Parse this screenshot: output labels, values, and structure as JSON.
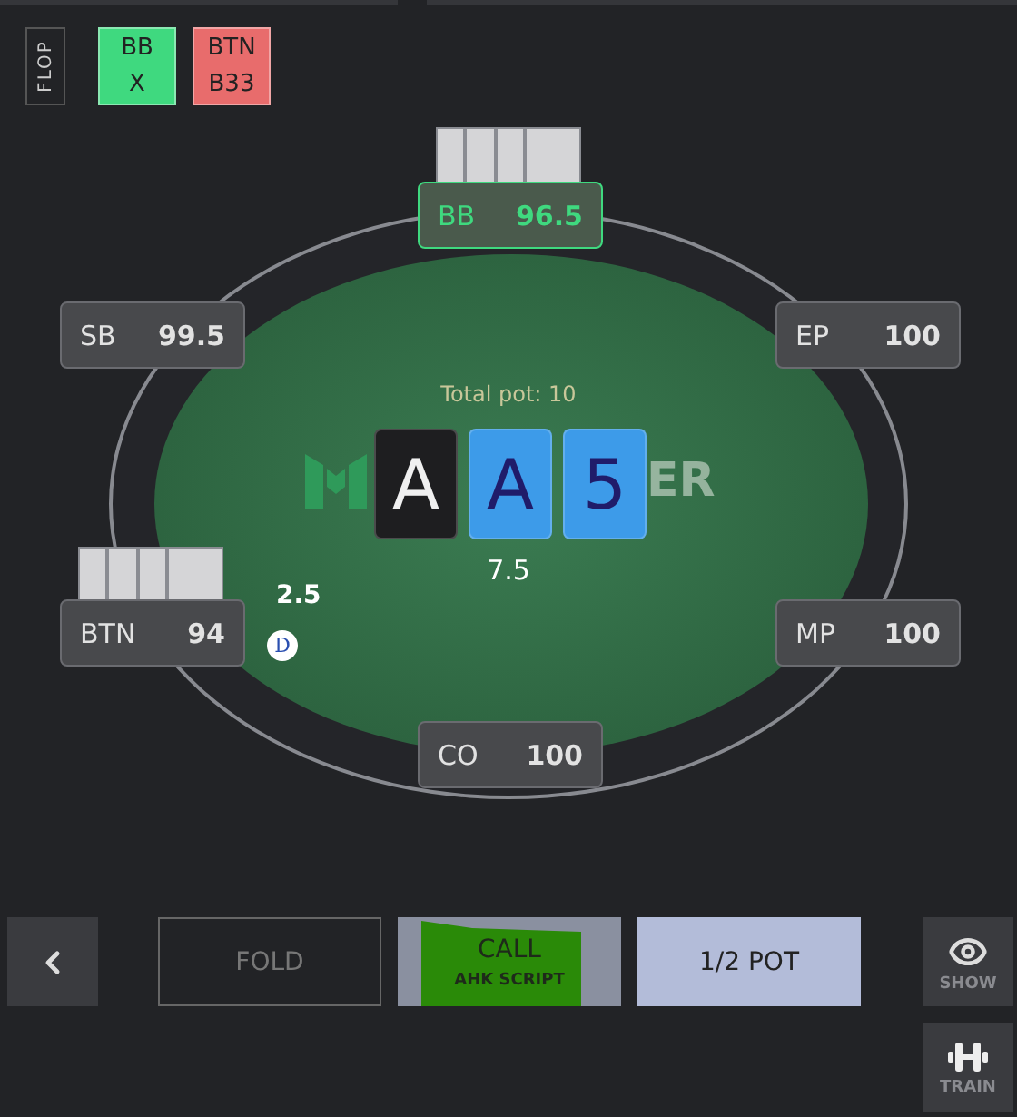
{
  "street": {
    "label": "FLOP"
  },
  "actions": [
    {
      "position": "BB",
      "action": "X",
      "color": "#3fd97f"
    },
    {
      "position": "BTN",
      "action": "B33",
      "color": "#e86c6c"
    }
  ],
  "seats": [
    {
      "position": "BB",
      "stack": "96.5",
      "active": true,
      "has_cards": true
    },
    {
      "position": "SB",
      "stack": "99.5",
      "active": false,
      "has_cards": false
    },
    {
      "position": "EP",
      "stack": "100",
      "active": false,
      "has_cards": false
    },
    {
      "position": "BTN",
      "stack": "94",
      "active": false,
      "has_cards": true,
      "dealer": true,
      "bet": "2.5"
    },
    {
      "position": "MP",
      "stack": "100",
      "active": false,
      "has_cards": false
    },
    {
      "position": "CO",
      "stack": "100",
      "active": false,
      "has_cards": false
    }
  ],
  "dealer_button": "D",
  "pot": {
    "total": "Total pot: 10",
    "current": "7.5"
  },
  "logo_text": "ER",
  "board": [
    {
      "rank": "A",
      "color": "#1e1e20"
    },
    {
      "rank": "A",
      "color": "#3d9be9"
    },
    {
      "rank": "5",
      "color": "#3d9be9"
    }
  ],
  "buttons": [
    {
      "label": "FOLD",
      "kind": "fold"
    },
    {
      "label": "CALL",
      "sublabel": "AHK SCRIPT",
      "kind": "call"
    },
    {
      "label": "1/2 POT",
      "kind": "raise"
    }
  ],
  "side_buttons": [
    {
      "label": "SHOW",
      "kind": "eye"
    },
    {
      "label": "TRAIN",
      "kind": "dumbbell"
    }
  ]
}
